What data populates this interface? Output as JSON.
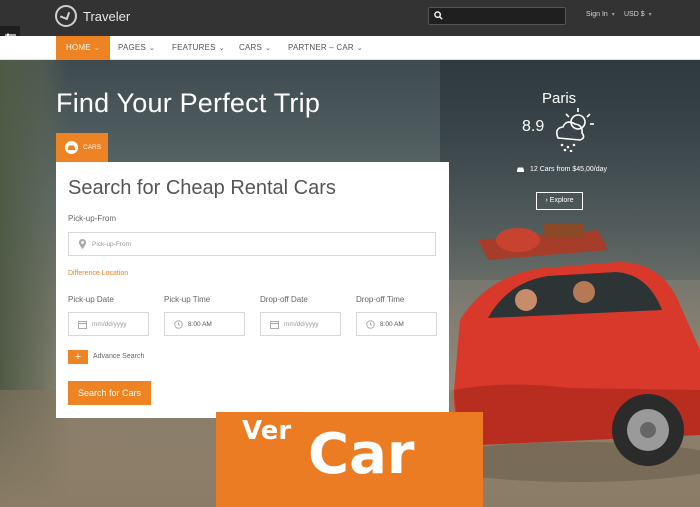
{
  "header": {
    "logo_text": "Traveler",
    "sign_in": "Sign In",
    "currency": "USD $"
  },
  "nav": {
    "items": [
      {
        "label": "HOME",
        "active": true
      },
      {
        "label": "PAGES"
      },
      {
        "label": "FEATURES"
      },
      {
        "label": "CARS"
      },
      {
        "label": "PARTNER – CAR"
      }
    ]
  },
  "hero": {
    "title": "Find Your Perfect Trip"
  },
  "weather": {
    "city": "Paris",
    "temperature": "8.9",
    "icon": "cloud-sun-icon"
  },
  "promo": {
    "cars_info": "12 Cars from $45,00/day",
    "explore_label": "Explore"
  },
  "search_tab": {
    "label": "CARS"
  },
  "form": {
    "title": "Search for Cheap Rental Cars",
    "pickup_from_label": "Pick-up-From",
    "pickup_from_placeholder": "Pick-up-From",
    "difference_location": "Difference Location",
    "pickup_date_label": "Pick-up Date",
    "pickup_date_value": "mm/dd/yyyy",
    "pickup_time_label": "Pick-up Time",
    "pickup_time_value": "8:00 AM",
    "dropoff_date_label": "Drop-off Date",
    "dropoff_date_value": "mm/dd/yyyy",
    "dropoff_time_label": "Drop-off Time",
    "dropoff_time_value": "8:00 AM",
    "advance_search": "Advance Search",
    "advance_plus": "+",
    "submit_label": "Search for Cars"
  },
  "banner": {
    "small_text": "Ver",
    "big_text": "Car"
  },
  "colors": {
    "accent": "#ed8323",
    "topbar": "#333333",
    "banner": "#ec7c23"
  }
}
